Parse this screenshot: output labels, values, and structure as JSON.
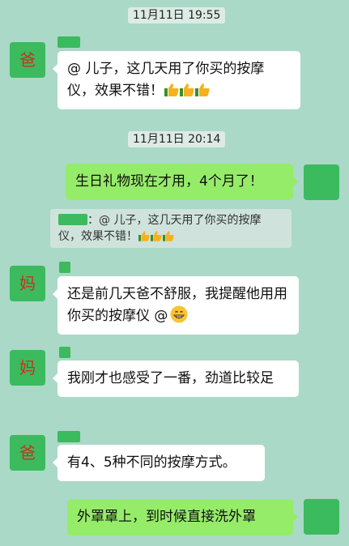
{
  "messages": {
    "ts1": "11月11日 19:55",
    "ts2": "11月11日 20:14",
    "m1": {
      "avatar": "爸",
      "text": "@ 儿子，这几天用了你买的按摩仪，效果不错！",
      "emoji": "thumbs-up-icon x3"
    },
    "m2": {
      "text": "生日礼物现在才用，4个月了！"
    },
    "quote": {
      "text": "：@ 儿子，这几天用了你买的按摩仪，效果不错！",
      "emoji": "thumbs-up-icon x3"
    },
    "m3": {
      "avatar": "妈",
      "text": "还是前几天爸不舒服，我提醒他用用你买的按摩仪 @",
      "emoji": "grinning-face-icon"
    },
    "m4": {
      "avatar": "妈",
      "text": "我刚才也感受了一番，劲道比较足"
    },
    "m5": {
      "avatar": "爸",
      "text": "有4、5种不同的按摩方式。"
    },
    "m6": {
      "text": "外罩罩上，到时候直接洗外罩"
    }
  },
  "colors": {
    "background": "#aad9c7",
    "incoming_bubble": "#ffffff",
    "outgoing_bubble": "#95ec69",
    "avatar_green": "#3cba5e",
    "avatar_text": "#c4341f"
  }
}
